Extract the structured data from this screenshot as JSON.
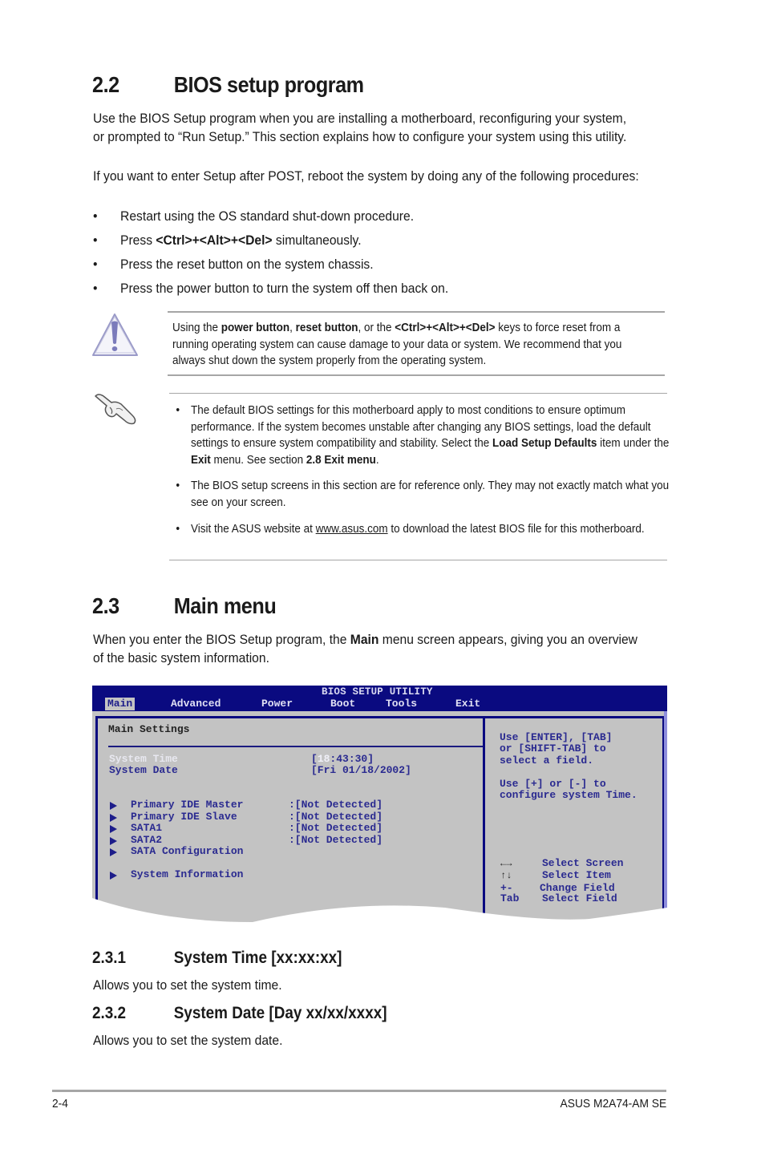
{
  "section_22": {
    "number": "2.2",
    "title": "BIOS setup program",
    "intro": "Use the BIOS Setup program when you are installing a motherboard, reconfiguring your system, or prompted to “Run Setup.” This section explains how to configure your system using this utility.",
    "post_intro": "If you want to enter Setup after POST, reboot the system by doing any of the following procedures:",
    "bullets": [
      {
        "pre": "Restart using the OS standard shut-down procedure.",
        "bold": "",
        "post": ""
      },
      {
        "pre": "Press ",
        "bold": "<Ctrl>+<Alt>+<Del>",
        "post": " simultaneously."
      },
      {
        "pre": "Press the reset button on the system chassis.",
        "bold": "",
        "post": ""
      },
      {
        "pre": "Press the power button to turn the system off then back on.",
        "bold": "",
        "post": ""
      }
    ],
    "warning": {
      "icon": "warning-triangle-icon",
      "t1": "Using the ",
      "b1": "power button",
      "t2": ", ",
      "b2": "reset button",
      "t3": ", or the ",
      "b3": "<Ctrl>+<Alt>+<Del>",
      "t4": " keys to force reset from a running operating system can cause damage to your data or system. We recommend that you always shut down the system properly from the operating system."
    },
    "note": {
      "icon": "hand-pointer-icon",
      "b1_t1": "The default BIOS settings for this motherboard apply to most conditions to ensure optimum performance. If the system becomes unstable after changing any BIOS settings, load the default settings to ensure system compatibility and stability. Select the ",
      "b1_b1": "Load Setup Defaults",
      "b1_t2": " item under the ",
      "b1_b2": "Exit",
      "b1_t3": " menu. See section ",
      "b1_b3": "2.8 Exit menu",
      "b1_t4": ".",
      "b2": "The BIOS setup screens in this section are for reference only. They may not exactly match what you see on your screen.",
      "b3_t1": "Visit the ASUS website at ",
      "b3_link": "www.asus.com",
      "b3_t2": " to download the latest BIOS file for this motherboard."
    }
  },
  "section_23": {
    "number": "2.3",
    "title": "Main menu",
    "t1": "When you enter the BIOS Setup program, the ",
    "b1": "Main",
    "t2": " menu screen appears, giving you an overview of the basic system information."
  },
  "bios": {
    "title": "BIOS SETUP UTILITY",
    "tabs": [
      "Main",
      "Advanced",
      "Power",
      "Boot",
      "Tools",
      "Exit"
    ],
    "active_tab": "Main",
    "heading": "Main Settings",
    "time_label": "System Time",
    "time_open": "[",
    "time_hl": "18",
    "time_rest": ":43:30]",
    "date_label": "System Date",
    "date_value": "[Fri 01/18/2002]",
    "items": [
      {
        "label": "Primary IDE Master",
        "value": ":[Not Detected]"
      },
      {
        "label": "Primary IDE Slave",
        "value": ":[Not Detected]"
      },
      {
        "label": "SATA1",
        "value": ":[Not Detected]"
      },
      {
        "label": "SATA2",
        "value": ":[Not Detected]"
      },
      {
        "label": "SATA Configuration",
        "value": ""
      },
      {
        "label": "System Information",
        "value": ""
      }
    ],
    "help": [
      "Use [ENTER], [TAB]",
      "or [SHIFT-TAB] to",
      "select a field.",
      "",
      "Use [+] or [-] to",
      "configure system Time."
    ],
    "keys": [
      {
        "key": "←→",
        "desc": "Select Screen"
      },
      {
        "key": "↑↓",
        "desc": "Select Item"
      },
      {
        "key": "+-",
        "desc": "Change Field"
      },
      {
        "key": "Tab",
        "desc": "Select Field"
      }
    ],
    "colors": {
      "frame": "#0a0a80",
      "panel": "#c3c3c3",
      "text": "#2a2a90"
    }
  },
  "section_231": {
    "number": "2.3.1",
    "title": "System Time [xx:xx:xx]",
    "desc": "Allows you to set the system time."
  },
  "section_232": {
    "number": "2.3.2",
    "title": "System Date [Day xx/xx/xxxx]",
    "desc": "Allows you to set the system date."
  },
  "footer": {
    "page": "2-4",
    "product": "ASUS M2A74-AM SE"
  }
}
